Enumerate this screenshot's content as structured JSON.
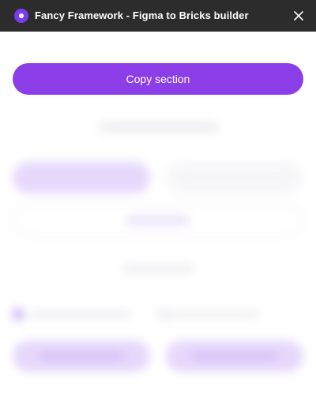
{
  "window": {
    "title": "Fancy Framework - Figma to Bricks builder",
    "icon": "plugin-icon",
    "accent": "#7c3aed"
  },
  "actions": {
    "copy_section_label": "Copy section"
  },
  "colors": {
    "titlebar_bg": "#2c2c2c",
    "primary_button": "#8b3ee8",
    "blurred_primary": "#e4d4fb"
  }
}
